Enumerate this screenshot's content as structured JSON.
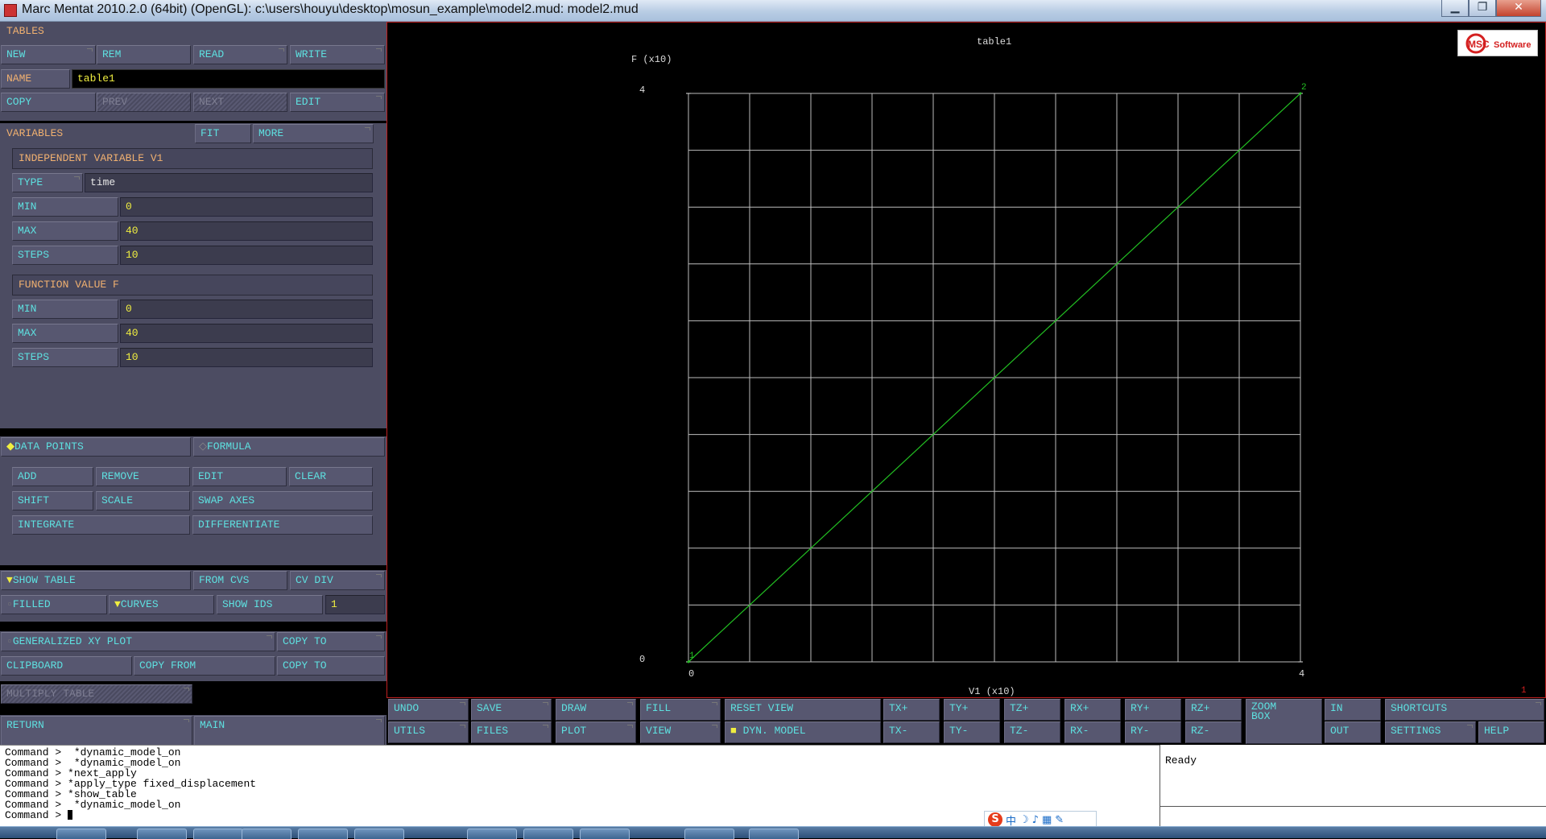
{
  "window": {
    "title": "Marc Mentat 2010.2.0 (64bit) (OpenGL): c:\\users\\houyu\\desktop\\mosun_example\\model2.mud: model2.mud",
    "controls": [
      "▁",
      "❐",
      "✕"
    ]
  },
  "tables": {
    "header": "TABLES",
    "new": "NEW",
    "rem": "REM",
    "read": "READ",
    "write": "WRITE",
    "name_label": "NAME",
    "name_value": "table1",
    "copy": "COPY",
    "prev": "PREV",
    "next": "NEXT",
    "edit": "EDIT"
  },
  "variables": {
    "header": "VARIABLES",
    "fit": "FIT",
    "more": "MORE",
    "independent_header": "INDEPENDENT VARIABLE V1",
    "type_label": "TYPE",
    "type_value": "time",
    "min_label": "MIN",
    "min_value": "0",
    "max_label": "MAX",
    "max_value": "40",
    "steps_label": "STEPS",
    "steps_value": "10",
    "function_header": "FUNCTION VALUE F",
    "f_min_label": "MIN",
    "f_min_value": "0",
    "f_max_label": "MAX",
    "f_max_value": "40",
    "f_steps_label": "STEPS",
    "f_steps_value": "10"
  },
  "points": {
    "data_points": "DATA POINTS",
    "formula": "FORMULA",
    "add": "ADD",
    "remove": "REMOVE",
    "edit": "EDIT",
    "clear": "CLEAR",
    "shift": "SHIFT",
    "scale": "SCALE",
    "swap_axes": "SWAP AXES",
    "integrate": "INTEGRATE",
    "differentiate": "DIFFERENTIATE"
  },
  "display": {
    "show_table": "SHOW TABLE",
    "from_cvs": "FROM CVS",
    "cv_div": "CV DIV",
    "filled": "FILLED",
    "curves": "CURVES",
    "show_ids": "SHOW IDS",
    "ids_value": "1",
    "generalized_xy_plot": "GENERALIZED XY PLOT",
    "copy_to_1": "COPY TO",
    "clipboard": "CLIPBOARD",
    "copy_from": "COPY FROM",
    "copy_to_2": "COPY TO",
    "multiply_table": "MULTIPLY TABLE"
  },
  "nav": {
    "return": "RETURN",
    "main": "MAIN"
  },
  "toolbar": {
    "row1": [
      "UNDO",
      "SAVE",
      "DRAW",
      "FILL",
      "RESET VIEW",
      "TX+",
      "TY+",
      "TZ+",
      "RX+",
      "RY+",
      "RZ+",
      "ZOOM BOX",
      "IN",
      "SHORTCUTS"
    ],
    "row2": [
      "UTILS",
      "FILES",
      "PLOT",
      "VIEW",
      "DYN. MODEL",
      "TX-",
      "TY-",
      "TZ-",
      "RX-",
      "RY-",
      "RZ-",
      "",
      "OUT",
      "SETTINGS",
      "HELP"
    ]
  },
  "chart_data": {
    "type": "line",
    "title": "table1",
    "xlabel": "V1 (x10)",
    "ylabel": "F (x10)",
    "xlim": [
      0,
      4
    ],
    "ylim": [
      0,
      4
    ],
    "x_tick_labels": [
      "0",
      "4"
    ],
    "y_tick_labels": [
      "0",
      "4"
    ],
    "grid": true,
    "grid_divisions": 10,
    "series": [
      {
        "points": [
          [
            0,
            0
          ],
          [
            4,
            4
          ]
        ],
        "point_ids": [
          "1",
          "2"
        ],
        "color": "#22c022"
      }
    ],
    "corner_label": "1"
  },
  "logo": {
    "text": "MSC Software"
  },
  "console": {
    "lines": [
      "Command >  *dynamic_model_on",
      "Command >  *dynamic_model_on",
      "Command > *next_apply",
      "Command > *apply_type fixed_displacement",
      "Command > *show_table",
      "Command >  *dynamic_model_on",
      "Command > "
    ]
  },
  "status": {
    "text": "Ready"
  },
  "ime": {
    "s": "S",
    "zh": "中"
  }
}
